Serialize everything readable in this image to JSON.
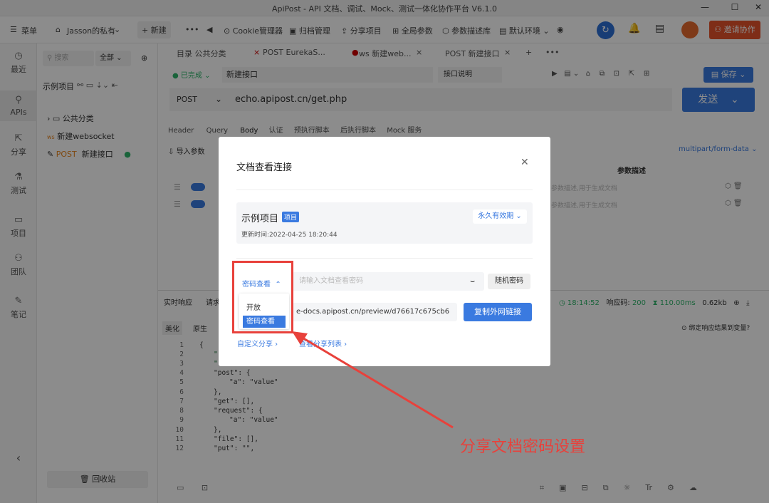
{
  "window": {
    "title": "ApiPost - API 文档、调试、Mock、测试一体化协作平台 V6.1.0",
    "minimize": "—",
    "maximize": "☐",
    "close": "✕"
  },
  "toolbar": {
    "menu": "菜单",
    "workspace": "Jasson的私有",
    "new": "新建",
    "cookie": "Cookie管理器",
    "archive": "归档管理",
    "share": "分享项目",
    "global": "全局参数",
    "params": "参数描述库",
    "env": "默认环境",
    "invite": "邀请协作"
  },
  "sidebar": {
    "items": [
      {
        "label": "最近",
        "icon": "clock-icon"
      },
      {
        "label": "APIs",
        "icon": "api-icon"
      },
      {
        "label": "分享",
        "icon": "share-icon"
      },
      {
        "label": "测试",
        "icon": "test-icon"
      },
      {
        "label": "项目",
        "icon": "project-icon"
      },
      {
        "label": "团队",
        "icon": "team-icon"
      },
      {
        "label": "笔记",
        "icon": "note-icon"
      }
    ]
  },
  "tree": {
    "search_placeholder": "搜索",
    "filter": "全部",
    "project": "示例项目",
    "items": [
      {
        "label": "公共分类",
        "prefix": ""
      },
      {
        "label": "新建websocket",
        "prefix": "ws"
      },
      {
        "label": "新建接口",
        "prefix": "POST"
      }
    ],
    "recycle": "回收站"
  },
  "tabs": [
    {
      "label": "目录 公共分类"
    },
    {
      "label": "POST EurekaS..."
    },
    {
      "label": "ws 新建web..."
    },
    {
      "label": "POST 新建接口"
    }
  ],
  "request": {
    "status": "已完成",
    "name": "新建接口",
    "doc_label": "接口说明",
    "save": "保存",
    "method": "POST",
    "url": "echo.apipost.cn/get.php",
    "send": "发送"
  },
  "req_tabs": [
    "Header",
    "Query",
    "Body",
    "认证",
    "预执行脚本",
    "后执行脚本",
    "Mock 服务"
  ],
  "body": {
    "import": "导入参数",
    "content_type": "multipart/form-data",
    "desc_header": "参数描述",
    "desc_placeholder": "参数描述,用于生成文档"
  },
  "response": {
    "tabs": [
      "实时响应",
      "请求"
    ],
    "view_tabs": [
      "美化",
      "原生"
    ],
    "time": "18:14:52",
    "status_label": "响应码:",
    "status_code": "200",
    "duration": "110.00ms",
    "size": "0.62kb",
    "bind_hint": "绑定响应结果到变量?"
  },
  "code": {
    "lines": [
      "{",
      "\"",
      "\"",
      "\"post\": {",
      "\"a\": \"value\"",
      "},",
      "\"get\": [],",
      "\"request\": {",
      "\"a\": \"value\"",
      "},",
      "\"file\": [],",
      "\"put\": \"\","
    ]
  },
  "modal": {
    "title": "文档查看连接",
    "project": "示例项目",
    "project_badge": "项目",
    "expiry": "永久有效期",
    "updated": "更新时间:2022-04-25 18:20:44",
    "password_select": "密码查看",
    "password_placeholder": "请输入文档查看密码",
    "random": "随机密码",
    "url": "e-docs.apipost.cn/preview/d76617c675cb6",
    "copy": "复制外网链接",
    "custom_share": "自定义分享",
    "share_list": "查看分享列表",
    "options": [
      "开放",
      "密码查看"
    ]
  },
  "annotation": {
    "text": "分享文档密码设置",
    "color": "#e8413b"
  }
}
